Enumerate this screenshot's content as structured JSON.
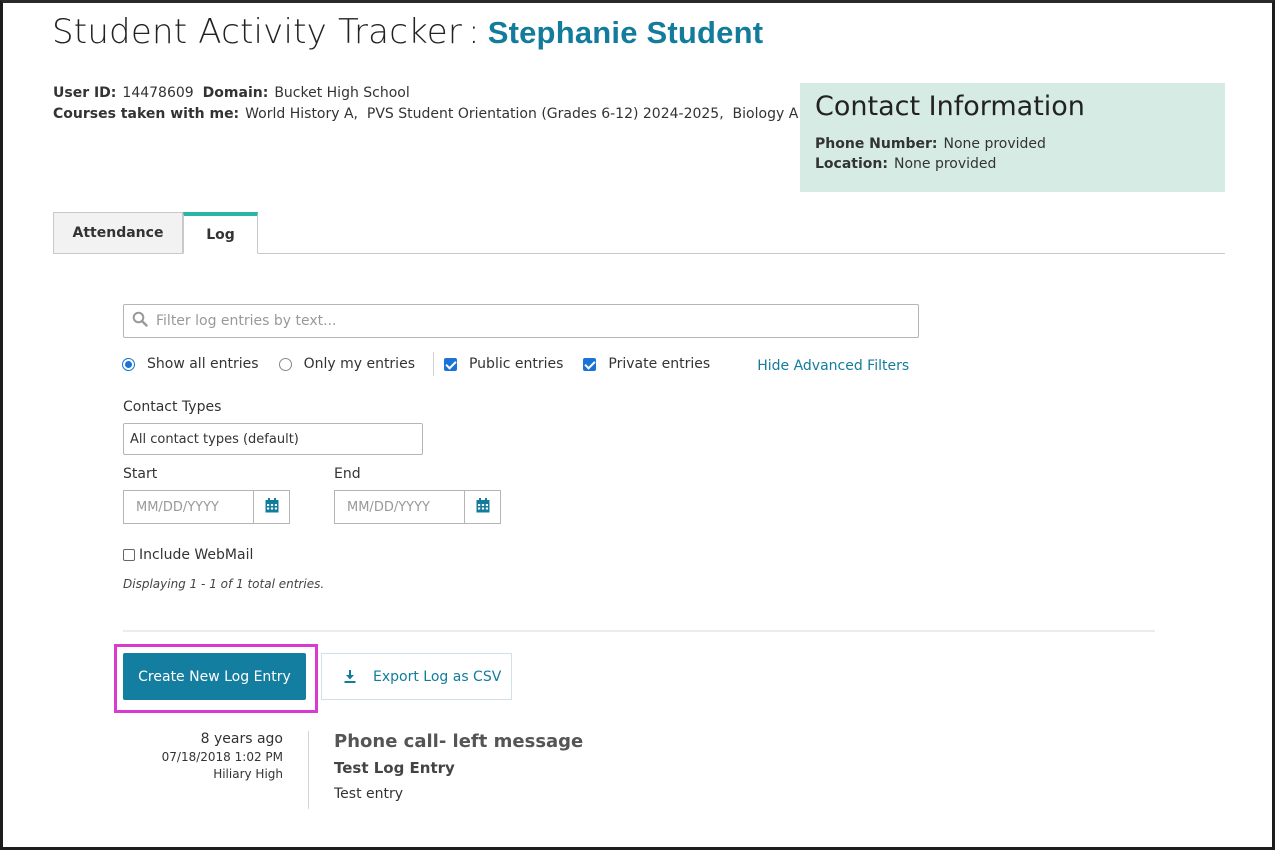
{
  "header": {
    "title": "Student Activity Tracker",
    "separator": ":",
    "student_name": "Stephanie Student"
  },
  "student_info": {
    "user_id_label": "User ID:",
    "user_id": "14478609",
    "domain_label": "Domain:",
    "domain": "Bucket High School",
    "courses_label": "Courses taken with me:",
    "courses": "World History A,  PVS Student Orientation (Grades 6-12) 2024-2025,  Biology A"
  },
  "contact": {
    "heading": "Contact Information",
    "phone_label": "Phone Number:",
    "phone_value": "None provided",
    "location_label": "Location:",
    "location_value": "None provided",
    "background_color": "#d5ebe3"
  },
  "tabs": [
    {
      "label": "Attendance",
      "active": false
    },
    {
      "label": "Log",
      "active": true
    }
  ],
  "search": {
    "placeholder": "Filter log entries by text...",
    "value": "",
    "icon": "search-icon"
  },
  "filters": {
    "show_all_label": "Show all entries",
    "show_all_selected": true,
    "only_mine_label": "Only my entries",
    "only_mine_selected": false,
    "public_label": "Public entries",
    "public_checked": true,
    "private_label": "Private entries",
    "private_checked": true,
    "advanced_toggle": "Hide Advanced Filters"
  },
  "contact_types": {
    "label": "Contact Types",
    "selected": "All contact types (default)"
  },
  "date_range": {
    "start_label": "Start",
    "start_placeholder": "MM/DD/YYYY",
    "end_label": "End",
    "end_placeholder": "MM/DD/YYYY",
    "calendar_icon": "calendar-icon"
  },
  "webmail": {
    "label": "Include WebMail",
    "checked": false
  },
  "results_note": "Displaying 1 - 1 of 1 total entries.",
  "actions": {
    "create_label": "Create New Log Entry",
    "export_label": "Export Log as CSV",
    "export_icon": "download-icon",
    "primary_color": "#137ea0",
    "highlight_color": "#d93ad1"
  },
  "log_entries": [
    {
      "relative_time": "8 years ago",
      "datetime": "07/18/2018 1:02 PM",
      "author": "Hiliary High",
      "contact_type": "Phone call- left message",
      "subject": "Test Log Entry",
      "body": "Test entry"
    }
  ],
  "accent_colors": {
    "link": "#137c9c",
    "active_tab": "#2bb5a7",
    "checkbox": "#1a73d6"
  }
}
